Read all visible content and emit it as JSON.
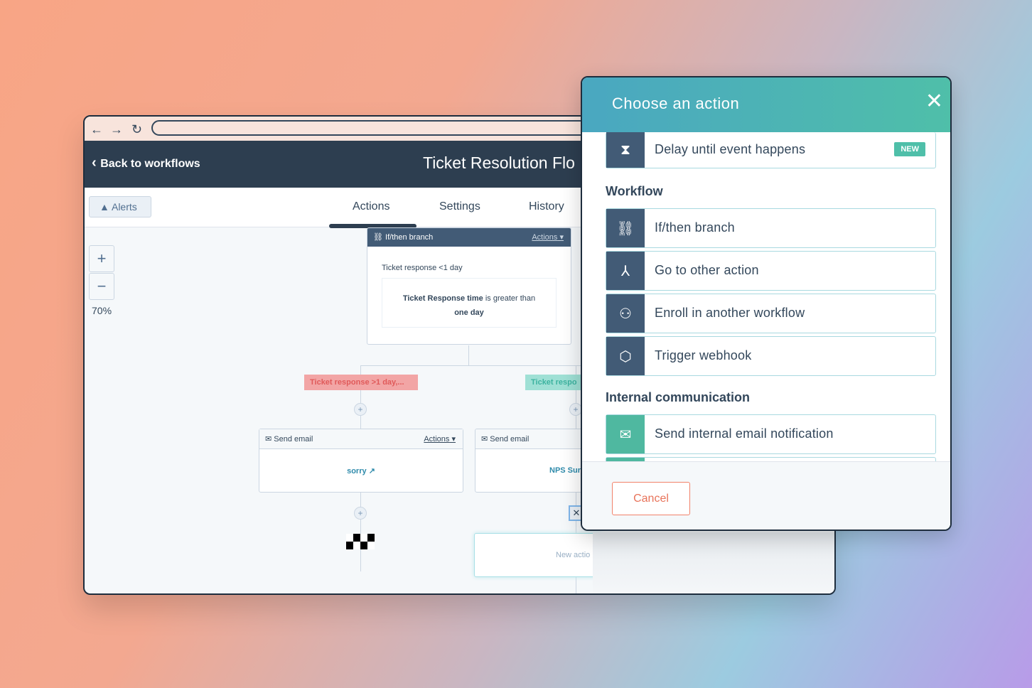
{
  "browser": {
    "back_icon": "arrow-left-icon",
    "forward_icon": "arrow-right-icon",
    "reload_icon": "reload-icon"
  },
  "header": {
    "back_label": "Back to workflows",
    "title": "Ticket Resolution Flo"
  },
  "toolbar": {
    "alerts_label": "Alerts",
    "tabs": [
      {
        "label": "Actions",
        "active": true
      },
      {
        "label": "Settings"
      },
      {
        "label": "History"
      }
    ]
  },
  "zoom": {
    "plus": "+",
    "minus": "−",
    "level": "70%"
  },
  "canvas": {
    "branch_card": {
      "title": "If/then branch",
      "actions": "Actions",
      "condition_name": "Ticket response <1 day",
      "condition_bold": "Ticket Response time",
      "condition_rest": " is greater than",
      "condition_value": "one day"
    },
    "branch_left_label": "Ticket response >1 day,...",
    "branch_right_label": "Ticket respo",
    "email_left": {
      "title": "Send email",
      "actions": "Actions",
      "link": "sorry"
    },
    "email_right": {
      "title": "Send email",
      "link": "NPS Sur"
    },
    "new_action": "New actio"
  },
  "modal": {
    "title": "Choose an action",
    "top_item": {
      "label": "Delay until event happens",
      "badge": "NEW",
      "icon": "hourglass-icon"
    },
    "sections": [
      {
        "title": "Workflow",
        "items": [
          {
            "label": "If/then branch",
            "icon": "branch-icon"
          },
          {
            "label": "Go to other action",
            "icon": "goto-icon"
          },
          {
            "label": "Enroll in another workflow",
            "icon": "enroll-icon"
          },
          {
            "label": "Trigger webhook",
            "icon": "cube-icon"
          }
        ]
      },
      {
        "title": "Internal communication",
        "items": [
          {
            "label": "Send internal email notification",
            "icon": "email-icon"
          }
        ]
      }
    ],
    "cancel_label": "Cancel"
  },
  "colors": {
    "header": "#2d3e50",
    "modal_header": "#4aa7c1",
    "icon_bg": "#425b76",
    "email_icon_bg": "#4fb8a0",
    "cancel": "#e8735a",
    "branch_red": "#f2a5a5",
    "branch_teal": "#9fe0d5"
  }
}
